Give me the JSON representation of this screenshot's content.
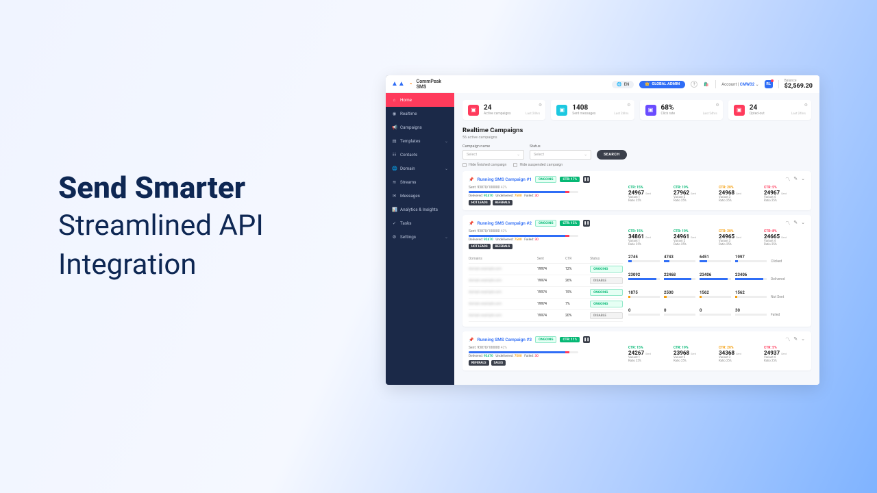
{
  "hero": {
    "title": "Send Smarter",
    "subtitle": "Streamlined API Integration"
  },
  "brand": {
    "name": "CommPeak SMS"
  },
  "topbar": {
    "lang": "EN",
    "admin_label": "GLOBAL ADMIN",
    "account_label": "Account",
    "account_id": "CMW32",
    "avatar": "RL",
    "balance_label": "Balance",
    "balance": "$2,569.20"
  },
  "nav": {
    "items": [
      {
        "label": "Home",
        "active": true
      },
      {
        "label": "Realtime"
      },
      {
        "label": "Campaigns"
      },
      {
        "label": "Templates",
        "chev": true
      },
      {
        "label": "Contacts"
      },
      {
        "label": "Domain",
        "chev": true
      },
      {
        "label": "Streams"
      },
      {
        "label": "Messages"
      },
      {
        "label": "Analytics & Insights"
      },
      {
        "label": "Tasks"
      },
      {
        "label": "Settings",
        "chev": true
      }
    ]
  },
  "kpis": [
    {
      "color": "#ff3b5c",
      "value": "24",
      "label": "Active campaigns",
      "sub": "Last 24hrs"
    },
    {
      "color": "#1cc8e0",
      "value": "1408",
      "label": "Sent messages",
      "sub": "Last 24hrs"
    },
    {
      "color": "#6a4cff",
      "value": "68%",
      "label": "Click rate",
      "sub": "Last 24hrs"
    },
    {
      "color": "#ff3b5c",
      "value": "24",
      "label": "Opted-out",
      "sub": "Last 24hrs"
    }
  ],
  "section": {
    "title": "Realtime Campaigns",
    "subtitle": "56 active campaigns"
  },
  "filters": {
    "name_label": "Campaign name",
    "status_label": "Status",
    "placeholder": "Select",
    "search": "SEARCH",
    "hide_finished": "Hide finished campaign",
    "hide_suspended": "Hide suspended campaign"
  },
  "campaigns": [
    {
      "name": "Running SMS Campaign #1",
      "status": "ONGOING",
      "ctr_badge": "CTR: 17%",
      "sent": "Sent: 93870/100000",
      "sent_pct": "42%",
      "delivered": "92470",
      "undelivered": "7500",
      "failed": "30",
      "tags": [
        "HOT LEADS",
        "REFERALS"
      ],
      "variants": [
        {
          "ctr": "CTR: 15%",
          "cls": "c15",
          "num": "24967",
          "label": "Variant 1",
          "ratio": "Ratio 25%"
        },
        {
          "ctr": "CTR: 19%",
          "cls": "c19",
          "num": "27962",
          "label": "Variant 2",
          "ratio": "Ratio 25%"
        },
        {
          "ctr": "CTR: 20%",
          "cls": "c20",
          "num": "24968",
          "label": "Variant 3",
          "ratio": "Ratio 25%"
        },
        {
          "ctr": "CTR: 5%",
          "cls": "c5",
          "num": "24967",
          "label": "Variant 4",
          "ratio": "Ratio 25%"
        }
      ]
    },
    {
      "name": "Running SMS Campaign #2",
      "status": "ONGOING",
      "ctr_badge": "CTR: 15%",
      "sent": "Sent: 93870/100000",
      "sent_pct": "42%",
      "delivered": "92470",
      "undelivered": "7500",
      "failed": "30",
      "tags": [
        "HOT LEADS",
        "REFERALS"
      ],
      "variants": [
        {
          "ctr": "CTR: 15%",
          "cls": "c15",
          "num": "34861",
          "label": "Variant 1",
          "ratio": "Ratio 25%"
        },
        {
          "ctr": "CTR: 19%",
          "cls": "c19",
          "num": "24961",
          "label": "Variant 2",
          "ratio": "Ratio 25%"
        },
        {
          "ctr": "CTR: 20%",
          "cls": "c20",
          "num": "24965",
          "label": "Variant 3",
          "ratio": "Ratio 25%"
        },
        {
          "ctr": "CTR: 8%",
          "cls": "c8",
          "num": "24665",
          "label": "Variant 4",
          "ratio": "Ratio 25%"
        }
      ],
      "domains_header": [
        "Domains",
        "Sent",
        "CTR",
        "Status"
      ],
      "domain_rows": [
        {
          "sent": "19974",
          "ctr": "12%",
          "status": "ONGOING"
        },
        {
          "sent": "19974",
          "ctr": "26%",
          "status": "DISABLE"
        },
        {
          "sent": "19974",
          "ctr": "15%",
          "status": "ONGOING"
        },
        {
          "sent": "19974",
          "ctr": "7%",
          "status": "ONGOING"
        },
        {
          "sent": "19974",
          "ctr": "20%",
          "status": "DISABLE"
        }
      ],
      "spark_rows": [
        {
          "vals": [
            "2745",
            "4743",
            "6451",
            "1997"
          ],
          "label": "Clicked",
          "colors": [
            "#2f6df6",
            "#2f6df6",
            "#2f6df6",
            "#2f6df6"
          ]
        },
        {
          "vals": [
            "23092",
            "22468",
            "23406",
            "23406"
          ],
          "label": "Delivered",
          "colors": [
            "#2f6df6",
            "#2f6df6",
            "#2f6df6",
            "#2f6df6"
          ]
        },
        {
          "vals": [
            "1875",
            "2500",
            "1562",
            "1562"
          ],
          "label": "Not Sent",
          "colors": [
            "#f59e0b",
            "#f59e0b",
            "#f59e0b",
            "#f59e0b"
          ]
        },
        {
          "vals": [
            "0",
            "0",
            "0",
            "30"
          ],
          "label": "Failed",
          "colors": [
            "#ff3b5c",
            "#ff3b5c",
            "#ff3b5c",
            "#ff3b5c"
          ]
        }
      ]
    },
    {
      "name": "Running SMS Campaign #3",
      "status": "ONGOING",
      "ctr_badge": "CTR: 11%",
      "sent": "Sent: 93870/100000",
      "sent_pct": "42%",
      "delivered": "92470",
      "undelivered": "7500",
      "failed": "30",
      "tags": [
        "REFERALS",
        "SALES"
      ],
      "variants": [
        {
          "ctr": "CTR: 15%",
          "cls": "c15",
          "num": "24267",
          "label": "Variant 1",
          "ratio": "Ratio 25%"
        },
        {
          "ctr": "CTR: 19%",
          "cls": "c19",
          "num": "23968",
          "label": "Variant 2",
          "ratio": "Ratio 25%"
        },
        {
          "ctr": "CTR: 20%",
          "cls": "c20",
          "num": "34368",
          "label": "Variant 3",
          "ratio": "Ratio 25%"
        },
        {
          "ctr": "CTR: 5%",
          "cls": "c5",
          "num": "24937",
          "label": "Variant 4",
          "ratio": "Ratio 25%"
        }
      ]
    }
  ],
  "labels": {
    "delivered": "Delivered:",
    "undelivered": "Undelivered:",
    "failed": "Failed:",
    "sent_suffix": "Sent"
  }
}
